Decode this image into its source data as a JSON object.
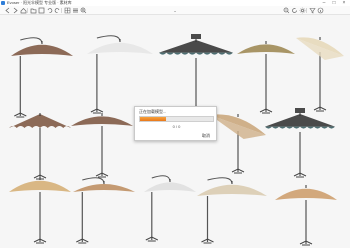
{
  "window": {
    "title": "Evoser · 阳光伞模型 专业版 · 素材库",
    "minimize_glyph": "–",
    "maximize_glyph": "□",
    "close_glyph": "×"
  },
  "toolbar": {
    "buttons": [
      {
        "name": "back-icon"
      },
      {
        "name": "forward-icon"
      },
      {
        "name": "home-icon"
      },
      {
        "name": "folder-icon"
      },
      {
        "name": "save-icon"
      },
      {
        "name": "undo-icon"
      },
      {
        "name": "redo-icon"
      },
      {
        "name": "grid-icon"
      },
      {
        "name": "list-icon"
      },
      {
        "name": "zoom-in-icon"
      },
      {
        "name": "zoom-out-icon"
      },
      {
        "name": "refresh-icon"
      },
      {
        "name": "settings-icon"
      },
      {
        "name": "filter-icon"
      },
      {
        "name": "info-icon"
      }
    ],
    "collapse_glyph": "⌄"
  },
  "dialog": {
    "title": "正在加载模型...",
    "progress": 0.36,
    "status_text": "0 / 0",
    "cancel_label": "取消"
  },
  "colors": {
    "accent": "#f08a24",
    "canopy_tan": "#b89a7e",
    "canopy_brown": "#8c6a57",
    "canopy_dark": "#4a4a4a",
    "canopy_cream": "#e8dcc0",
    "canopy_teal_trim": "#4e6f73",
    "pole": "#555555"
  }
}
